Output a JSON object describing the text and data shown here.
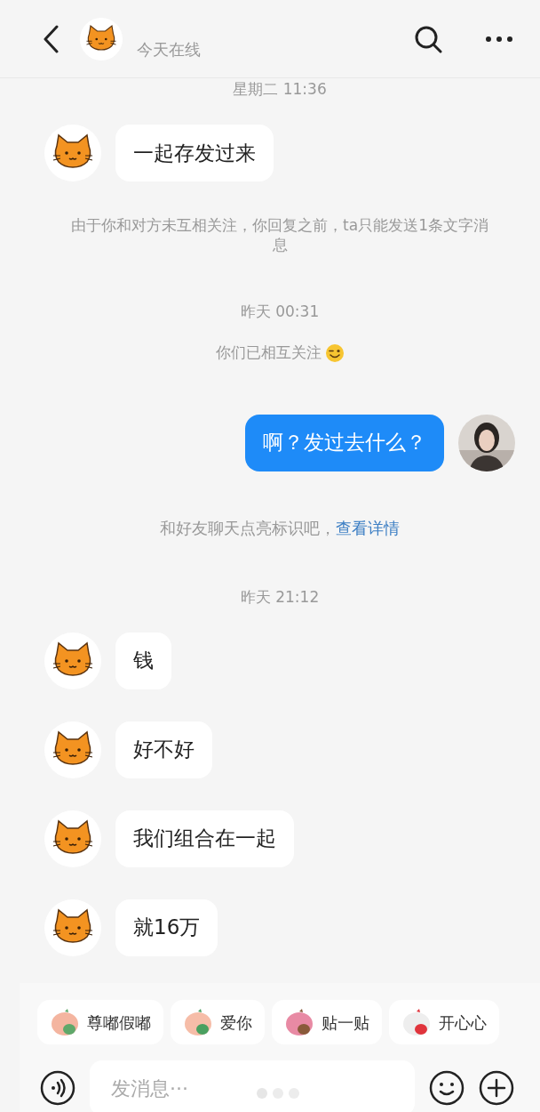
{
  "header": {
    "status": "今天在线"
  },
  "messages": [
    {
      "kind": "time",
      "text": "星期二 11:36"
    },
    {
      "kind": "incoming",
      "text": "一起存发过来"
    },
    {
      "kind": "system",
      "text": "由于你和对方未互相关注，你回复之前，ta只能发送1条文字消息"
    },
    {
      "kind": "time",
      "text": "昨天 00:31"
    },
    {
      "kind": "followed",
      "text": "你们已相互关注"
    },
    {
      "kind": "outgoing",
      "text": "啊？发过去什么？"
    },
    {
      "kind": "hint",
      "text": "和好友聊天点亮标识吧，",
      "link": "查看详情"
    },
    {
      "kind": "time",
      "text": "昨天 21:12"
    },
    {
      "kind": "incoming",
      "text": "钱"
    },
    {
      "kind": "incoming",
      "text": "好不好"
    },
    {
      "kind": "incoming",
      "text": "我们组合在一起"
    },
    {
      "kind": "incoming",
      "text": "就16万"
    }
  ],
  "stickers": [
    "尊嘟假嘟",
    "爱你",
    "贴一贴",
    "开心心"
  ],
  "composer": {
    "placeholder": "发消息···"
  }
}
